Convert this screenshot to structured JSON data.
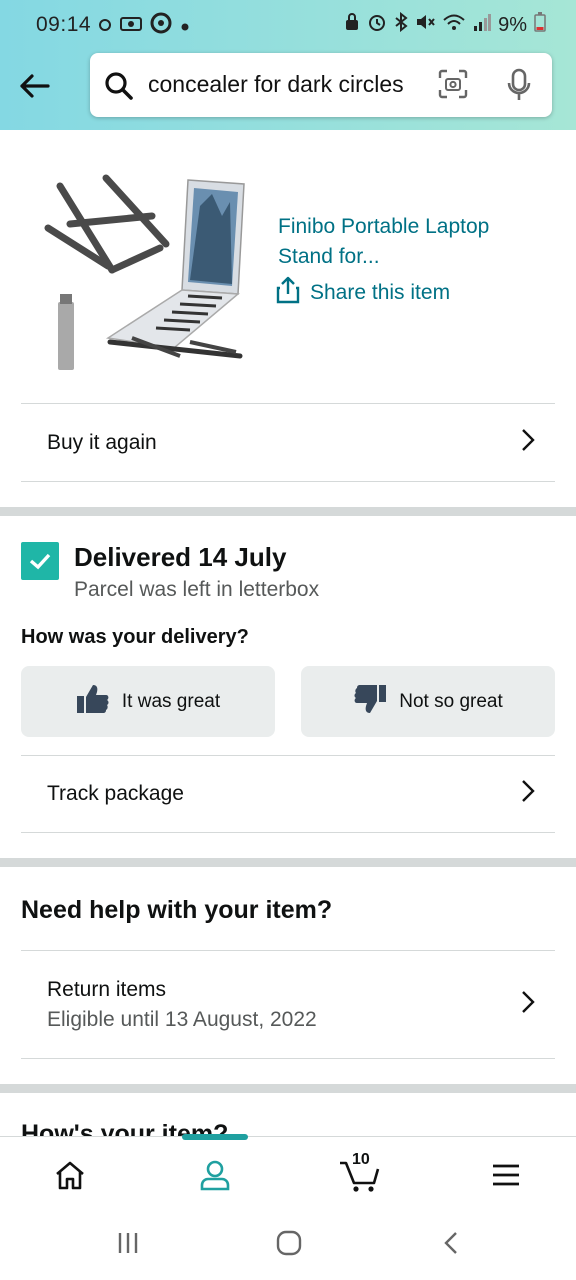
{
  "status": {
    "time": "09:14",
    "battery": "9%"
  },
  "search": {
    "query": "concealer for dark circles"
  },
  "product": {
    "title": "Finibo Portable Laptop Stand for...",
    "share_label": "Share this item"
  },
  "buy_again": "Buy it again",
  "delivery": {
    "title": "Delivered 14 July",
    "note": "Parcel was left in letterbox",
    "question": "How was your delivery?",
    "great_label": "It was great",
    "not_great_label": "Not so great"
  },
  "track_package": "Track package",
  "help": {
    "heading": "Need help with your item?",
    "return_label": "Return items",
    "return_sub": "Eligible until 13 August, 2022"
  },
  "next_heading": "How's your item?",
  "nav": {
    "cart_count": "10"
  },
  "colors": {
    "accent": "#007185",
    "teal": "#1fb6a7",
    "nav_indicator": "#1fa0a0"
  }
}
